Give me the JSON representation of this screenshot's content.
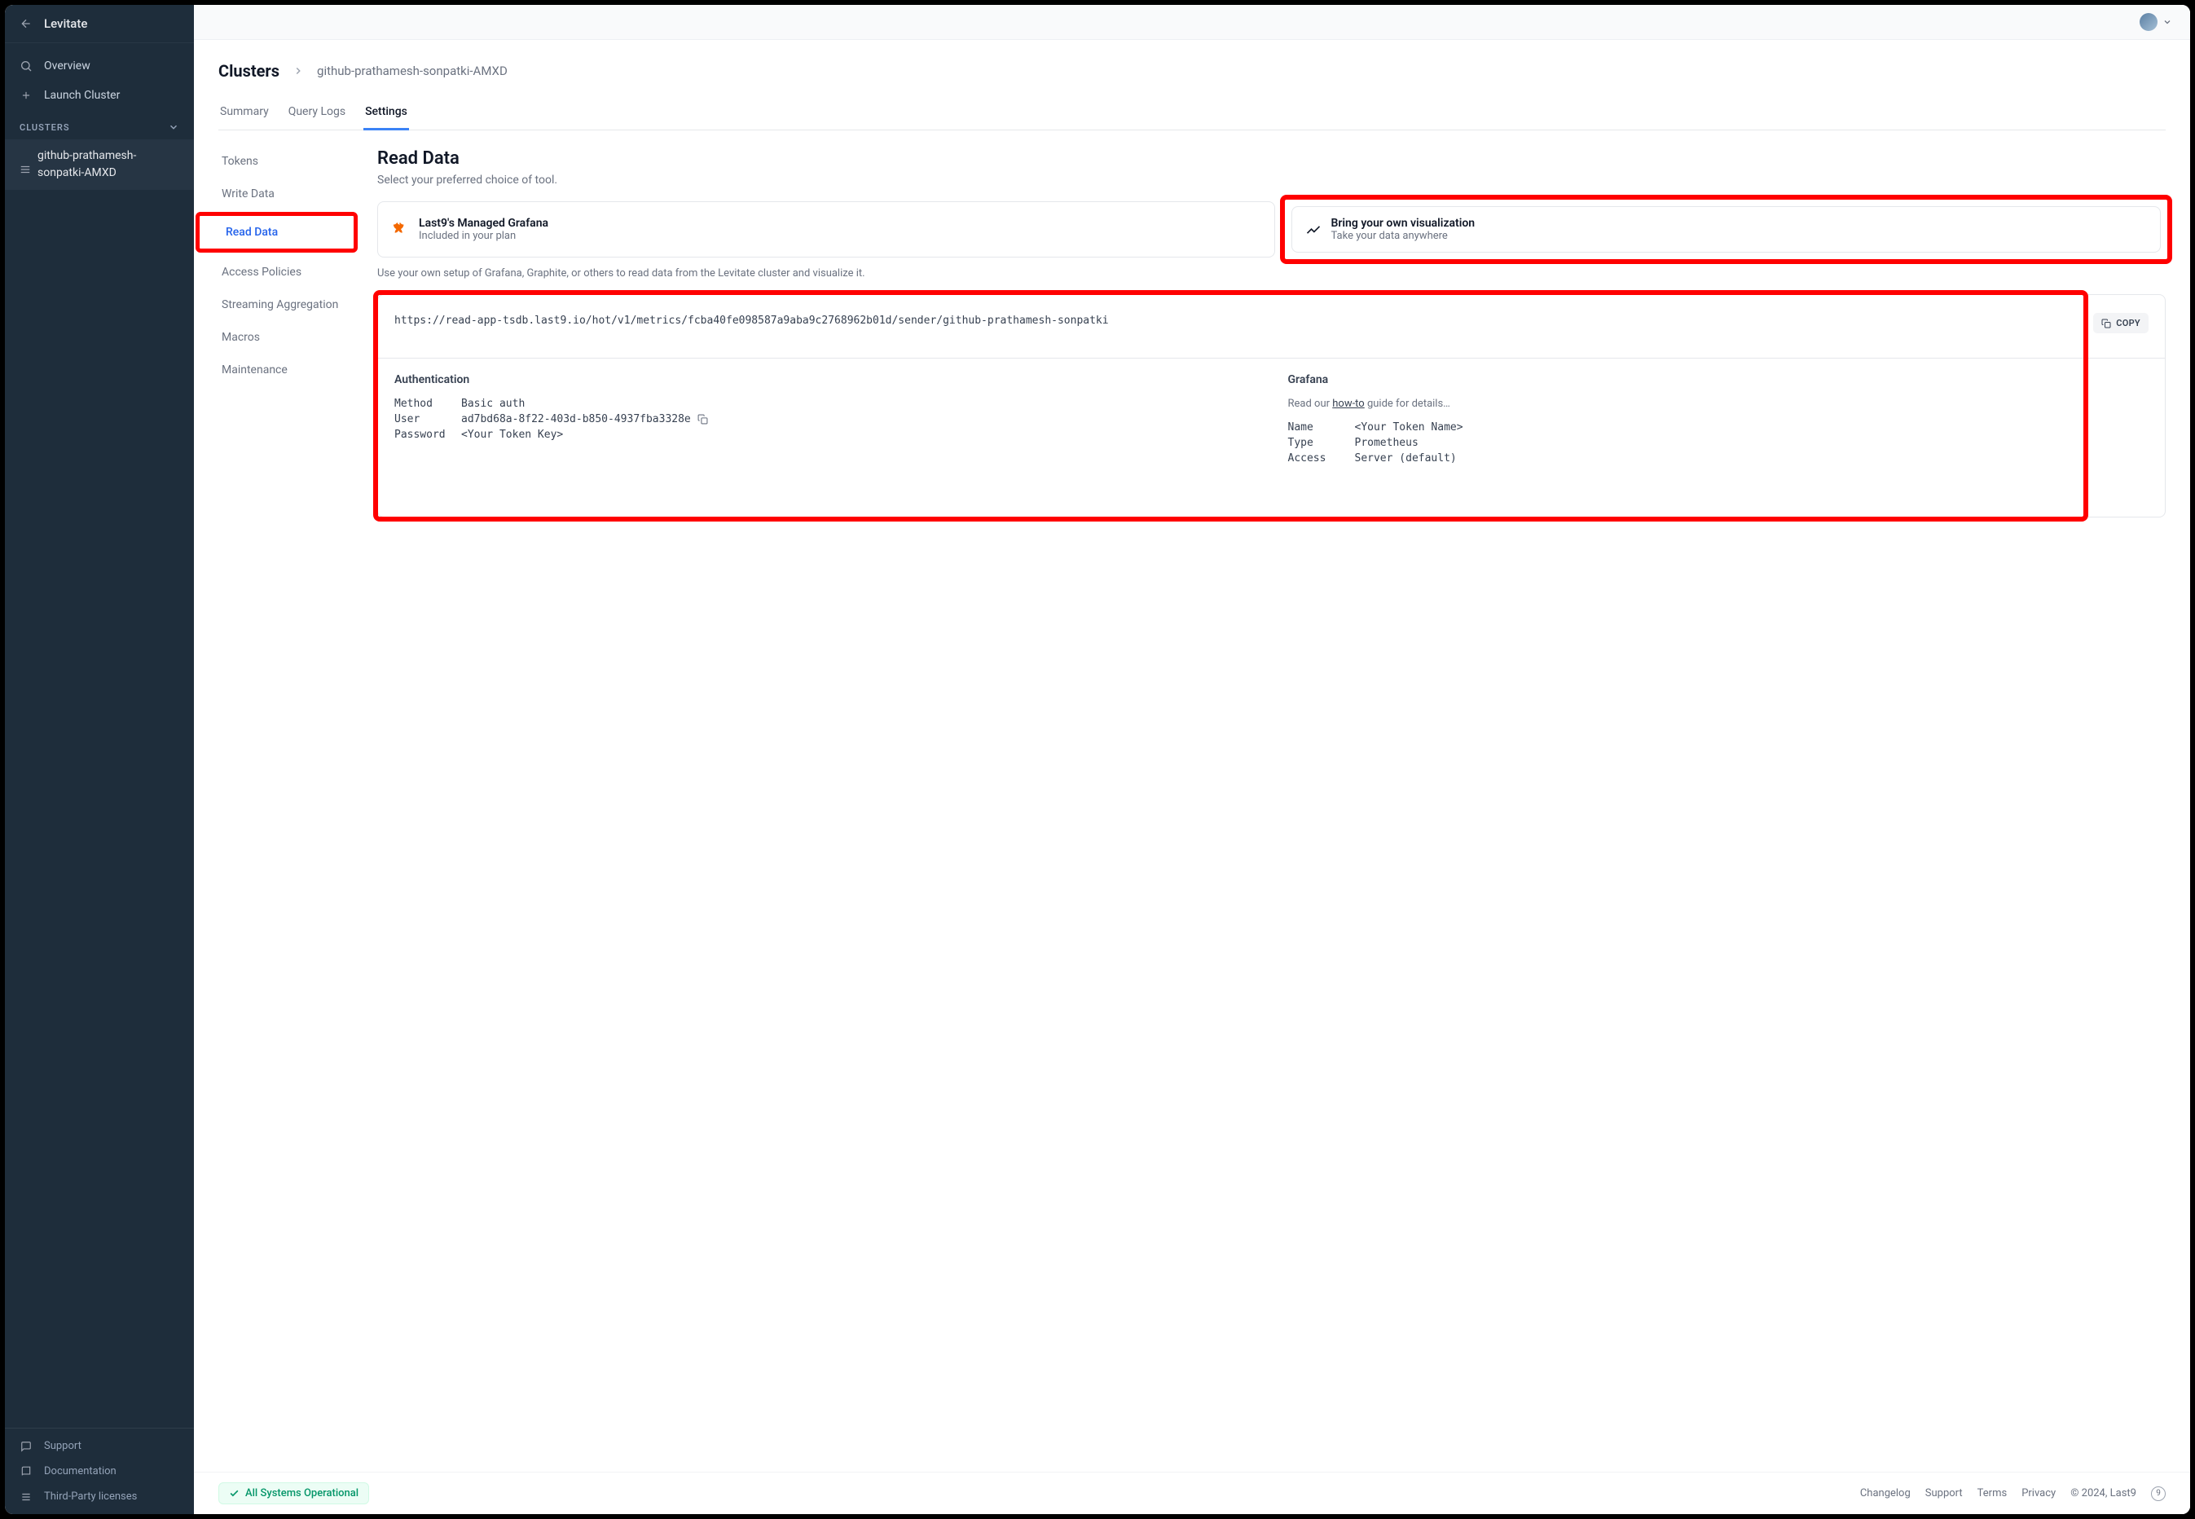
{
  "sidebar": {
    "title": "Levitate",
    "overview": "Overview",
    "launch": "Launch Cluster",
    "clusters_heading": "CLUSTERS",
    "cluster_name": "github-prathamesh-sonpatki-AMXD",
    "support": "Support",
    "documentation": "Documentation",
    "licenses": "Third-Party licenses"
  },
  "breadcrumb": {
    "root": "Clusters",
    "leaf": "github-prathamesh-sonpatki-AMXD"
  },
  "tabs": {
    "summary": "Summary",
    "querylogs": "Query Logs",
    "settings": "Settings"
  },
  "settings_menu": {
    "tokens": "Tokens",
    "write": "Write Data",
    "read": "Read Data",
    "policies": "Access Policies",
    "streaming": "Streaming Aggregation",
    "macros": "Macros",
    "maintenance": "Maintenance"
  },
  "page": {
    "title": "Read Data",
    "subtitle": "Select your preferred choice of tool.",
    "card1_title": "Last9's Managed Grafana",
    "card1_sub": "Included in your plan",
    "card2_title": "Bring your own visualization",
    "card2_sub": "Take your data anywhere",
    "desc": "Use your own setup of Grafana, Graphite, or others to read data from the Levitate cluster and visualize it.",
    "url": "https://read-app-tsdb.last9.io/hot/v1/metrics/fcba40fe098587a9aba9c2768962b01d/sender/github-prathamesh-sonpatki",
    "copy": "COPY",
    "auth_heading": "Authentication",
    "auth_method_k": "Method",
    "auth_method_v": "Basic auth",
    "auth_user_k": "User",
    "auth_user_v": "ad7bd68a-8f22-403d-b850-4937fba3328e",
    "auth_pass_k": "Password",
    "auth_pass_v": "<Your Token Key>",
    "grafana_heading": "Grafana",
    "grafana_hint_pre": "Read our ",
    "grafana_hint_link": "how-to",
    "grafana_hint_post": " guide for details…",
    "grafana_name_k": "Name",
    "grafana_name_v": "<Your Token Name>",
    "grafana_type_k": "Type",
    "grafana_type_v": "Prometheus",
    "grafana_access_k": "Access",
    "grafana_access_v": "Server (default)"
  },
  "statusbar": {
    "status": "All Systems Operational",
    "changelog": "Changelog",
    "support": "Support",
    "terms": "Terms",
    "privacy": "Privacy",
    "copyright": "© 2024, Last9",
    "badge": "9"
  }
}
